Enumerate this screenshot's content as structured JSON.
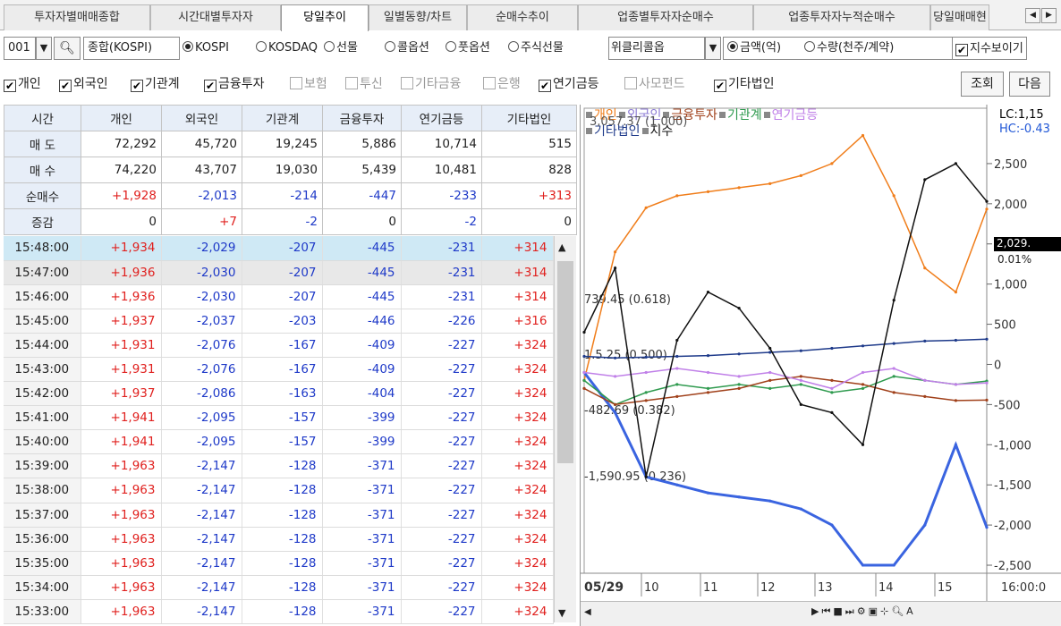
{
  "tabs": [
    "투자자별매매종합",
    "시간대별투자자",
    "당일추이",
    "일별동향/차트",
    "순매수추이",
    "업종별투자자순매수",
    "업종투자자누적순매수",
    "당일매매현"
  ],
  "active_tab": 2,
  "toolbar": {
    "code": "001",
    "market_name": "종합(KOSPI)",
    "markets": [
      "KOSPI",
      "KOSDAQ",
      "선물",
      "콜옵션",
      "풋옵션",
      "주식선물",
      "위클리콜옵"
    ],
    "units": [
      "금액(억)",
      "수량(천주/계약)"
    ],
    "show_index_label": "지수보이기"
  },
  "investor_filters": [
    {
      "label": "개인",
      "checked": true
    },
    {
      "label": "외국인",
      "checked": true
    },
    {
      "label": "기관계",
      "checked": true
    },
    {
      "label": "금융투자",
      "checked": true
    },
    {
      "label": "보험",
      "checked": false
    },
    {
      "label": "투신",
      "checked": false
    },
    {
      "label": "기타금융",
      "checked": false
    },
    {
      "label": "은행",
      "checked": false
    },
    {
      "label": "연기금등",
      "checked": true
    },
    {
      "label": "사모펀드",
      "checked": false
    },
    {
      "label": "기타법인",
      "checked": true
    }
  ],
  "buttons": {
    "query": "조회",
    "next": "다음"
  },
  "summary": {
    "headers": [
      "시간",
      "개인",
      "외국인",
      "기관계",
      "금융투자",
      "연기금등",
      "기타법인"
    ],
    "rows": [
      {
        "label": "매 도",
        "values": [
          "72,292",
          "45,720",
          "19,245",
          "5,886",
          "10,714",
          "515"
        ]
      },
      {
        "label": "매 수",
        "values": [
          "74,220",
          "43,707",
          "19,030",
          "5,439",
          "10,481",
          "828"
        ]
      },
      {
        "label": "순매수",
        "values": [
          "+1,928",
          "-2,013",
          "-214",
          "-447",
          "-233",
          "+313"
        ]
      },
      {
        "label": "증감",
        "values": [
          "0",
          "+7",
          "-2",
          "0",
          "-2",
          "0"
        ]
      }
    ]
  },
  "rows": [
    [
      "15:48:00",
      "+1,934",
      "-2,029",
      "-207",
      "-445",
      "-231",
      "+314"
    ],
    [
      "15:47:00",
      "+1,936",
      "-2,030",
      "-207",
      "-445",
      "-231",
      "+314"
    ],
    [
      "15:46:00",
      "+1,936",
      "-2,030",
      "-207",
      "-445",
      "-231",
      "+314"
    ],
    [
      "15:45:00",
      "+1,937",
      "-2,037",
      "-203",
      "-446",
      "-226",
      "+316"
    ],
    [
      "15:44:00",
      "+1,931",
      "-2,076",
      "-167",
      "-409",
      "-227",
      "+324"
    ],
    [
      "15:43:00",
      "+1,931",
      "-2,076",
      "-167",
      "-409",
      "-227",
      "+324"
    ],
    [
      "15:42:00",
      "+1,937",
      "-2,086",
      "-163",
      "-404",
      "-227",
      "+324"
    ],
    [
      "15:41:00",
      "+1,941",
      "-2,095",
      "-157",
      "-399",
      "-227",
      "+324"
    ],
    [
      "15:40:00",
      "+1,941",
      "-2,095",
      "-157",
      "-399",
      "-227",
      "+324"
    ],
    [
      "15:39:00",
      "+1,963",
      "-2,147",
      "-128",
      "-371",
      "-227",
      "+324"
    ],
    [
      "15:38:00",
      "+1,963",
      "-2,147",
      "-128",
      "-371",
      "-227",
      "+324"
    ],
    [
      "15:37:00",
      "+1,963",
      "-2,147",
      "-128",
      "-371",
      "-227",
      "+324"
    ],
    [
      "15:36:00",
      "+1,963",
      "-2,147",
      "-128",
      "-371",
      "-227",
      "+324"
    ],
    [
      "15:35:00",
      "+1,963",
      "-2,147",
      "-128",
      "-371",
      "-227",
      "+324"
    ],
    [
      "15:34:00",
      "+1,963",
      "-2,147",
      "-128",
      "-371",
      "-227",
      "+324"
    ],
    [
      "15:33:00",
      "+1,963",
      "-2,147",
      "-128",
      "-371",
      "-227",
      "+324"
    ]
  ],
  "chart": {
    "legend_row1": [
      {
        "name": "개인",
        "color": "#f07d1a"
      },
      {
        "name": "외국인",
        "color": "#8e7cd6"
      },
      {
        "name": "금융투자",
        "color": "#a0401a"
      },
      {
        "name": "기관계",
        "color": "#2e9a4e"
      },
      {
        "name": "연기금등",
        "color": "#c080e8"
      }
    ],
    "legend_row2": [
      {
        "name": "기타법인",
        "color": "#1e3a8a"
      },
      {
        "name": "지수",
        "color": "#111111"
      }
    ],
    "overlay_text": "3,057.37 (1.000)",
    "lc_label": "LC:1,15",
    "hc_label": "HC:-0.43",
    "annotations": [
      "739.45 (0.618)",
      "1.5.25 (0.500)",
      "-482.69 (0.382)",
      "-1,590.95 (0.236)"
    ],
    "y_ticks": [
      "2,500",
      "2,000",
      "1,500",
      "1,000",
      "500",
      "0",
      "-500",
      "-1,000",
      "-1,500",
      "-2,000",
      "-2,500"
    ],
    "last_value": "2,029.",
    "last_pct": "0.01%",
    "x_date": "05/29",
    "x_ticks": [
      "10",
      "11",
      "12",
      "13",
      "14",
      "15"
    ],
    "x_end": "16:00:0"
  },
  "chart_data": {
    "type": "line",
    "x": [
      "09:00",
      "09:30",
      "10:00",
      "10:30",
      "11:00",
      "11:30",
      "12:00",
      "12:30",
      "13:00",
      "13:30",
      "14:00",
      "14:30",
      "15:00",
      "15:30"
    ],
    "ylim": [
      -2600,
      2900
    ],
    "series": [
      {
        "name": "개인",
        "values": [
          -200,
          1400,
          1950,
          2100,
          2150,
          2200,
          2250,
          2350,
          2500,
          2850,
          2100,
          1200,
          900,
          1934
        ]
      },
      {
        "name": "외국인",
        "values": [
          -100,
          -600,
          -1400,
          -1500,
          -1600,
          -1650,
          -1700,
          -1800,
          -2000,
          -2500,
          -2500,
          -2000,
          -1000,
          -2029
        ]
      },
      {
        "name": "기관계",
        "values": [
          -200,
          -500,
          -350,
          -250,
          -300,
          -250,
          -300,
          -250,
          -350,
          -300,
          -150,
          -200,
          -250,
          -207
        ]
      },
      {
        "name": "금융투자",
        "values": [
          -300,
          -500,
          -450,
          -400,
          -350,
          -300,
          -200,
          -150,
          -200,
          -250,
          -350,
          -400,
          -450,
          -445
        ]
      },
      {
        "name": "연기금등",
        "values": [
          -100,
          -150,
          -100,
          -50,
          -100,
          -150,
          -100,
          -200,
          -300,
          -100,
          -50,
          -200,
          -250,
          -231
        ]
      },
      {
        "name": "기타법인",
        "values": [
          100,
          80,
          90,
          100,
          110,
          130,
          150,
          170,
          200,
          230,
          260,
          290,
          300,
          314
        ]
      },
      {
        "name": "지수",
        "values": [
          400,
          1200,
          -1400,
          300,
          900,
          700,
          200,
          -500,
          -600,
          -1000,
          800,
          2300,
          2500,
          2029
        ]
      }
    ]
  }
}
